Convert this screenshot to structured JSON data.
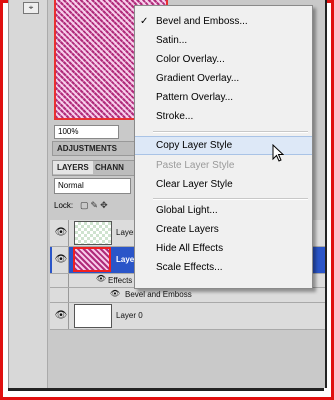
{
  "zoom": "100%",
  "tabs": [
    "ADJUSTMENTS",
    "LAYERS",
    "CHANNELS"
  ],
  "tabs_visible": [
    "ADJUSTMENTS",
    "LAYERS",
    "CHANN"
  ],
  "blend_mode": "Normal",
  "lock_label": "Lock:",
  "layers": [
    {
      "name": "Layer",
      "thumb": "checker",
      "selected": false
    },
    {
      "name": "Layer",
      "thumb": "pink",
      "selected": true
    },
    {
      "name": "Layer 0",
      "thumb": "white",
      "selected": false
    }
  ],
  "effects_label": "Effects",
  "effect_item": "Bevel and Emboss",
  "context_menu": {
    "items": [
      {
        "label": "Bevel and Emboss...",
        "checked": true,
        "enabled": true
      },
      {
        "label": "Satin...",
        "checked": false,
        "enabled": true
      },
      {
        "label": "Color Overlay...",
        "checked": false,
        "enabled": true
      },
      {
        "label": "Gradient Overlay...",
        "checked": false,
        "enabled": true
      },
      {
        "label": "Pattern Overlay...",
        "checked": false,
        "enabled": true
      },
      {
        "label": "Stroke...",
        "checked": false,
        "enabled": true
      },
      {
        "label": "Copy Layer Style",
        "checked": false,
        "enabled": true,
        "hover": true
      },
      {
        "label": "Paste Layer Style",
        "checked": false,
        "enabled": false
      },
      {
        "label": "Clear Layer Style",
        "checked": false,
        "enabled": true
      },
      {
        "label": "Global Light...",
        "checked": false,
        "enabled": true
      },
      {
        "label": "Create Layers",
        "checked": false,
        "enabled": true
      },
      {
        "label": "Hide All Effects",
        "checked": false,
        "enabled": true
      },
      {
        "label": "Scale Effects...",
        "checked": false,
        "enabled": true
      }
    ]
  },
  "colors": {
    "frame": "#e01010",
    "selection": "#2a55c8",
    "menu_hover": "#dde8f7"
  }
}
